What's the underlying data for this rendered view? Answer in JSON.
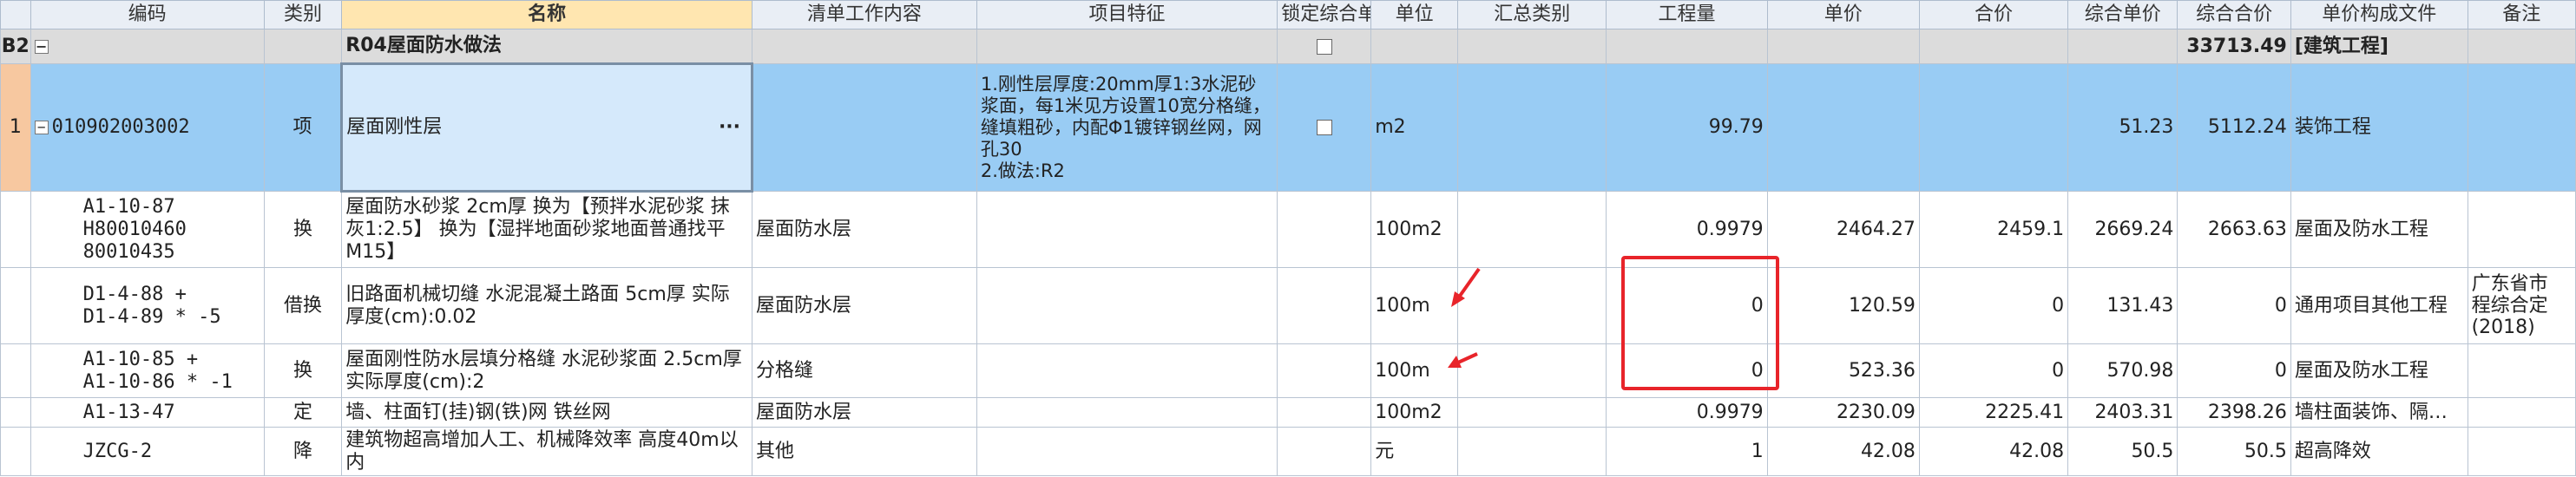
{
  "headers": [
    "",
    "编码",
    "类别",
    "名称",
    "清单工作内容",
    "项目特征",
    "锁定综合单价",
    "单位",
    "汇总类别",
    "工程量",
    "单价",
    "合价",
    "综合单价",
    "综合合价",
    "单价构成文件",
    "备注"
  ],
  "group_row": {
    "row_id": "B2",
    "name": "R04屋面防水做法",
    "total": "33713.49",
    "file": "[建筑工程]"
  },
  "selected_row": {
    "row_num": "1",
    "code": "010902003002",
    "type": "项",
    "name": "屋面刚性层",
    "ellipsis": "···",
    "feature": "1.刚性层厚度:20mm厚1:3水泥砂浆面，每1米见方设置10宽分格缝，缝填粗砂，内配Φ1镀锌钢丝网，网孔30\n2.做法:R2",
    "unit": "m2",
    "qty": "99.79",
    "comp_price": "51.23",
    "comp_total": "5112.24",
    "file": "装饰工程"
  },
  "rows": [
    {
      "code": "A1-10-87\nH80010460\n80010435",
      "type": "换",
      "name": "屋面防水砂浆 2cm厚  换为【预拌水泥砂浆 抹灰1:2.5】  换为【湿拌地面砂浆地面普通找平 M15】",
      "content": "屋面防水层",
      "unit": "100m2",
      "qty": "0.9979",
      "price": "2464.27",
      "total": "2459.1",
      "comp_price": "2669.24",
      "comp_total": "2663.63",
      "file": "屋面及防水工程",
      "remark": ""
    },
    {
      "code": "D1-4-88 +\nD1-4-89 * -5",
      "type": "借换",
      "name": "旧路面机械切缝 水泥混凝土路面 5cm厚  实际厚度(cm):0.02",
      "content": "屋面防水层",
      "unit": "100m",
      "qty": "0",
      "price": "120.59",
      "total": "0",
      "comp_price": "131.43",
      "comp_total": "0",
      "file": "通用项目其他工程",
      "remark": "广东省市\n程综合定\n(2018)"
    },
    {
      "code": "A1-10-85 +\nA1-10-86 * -1",
      "type": "换",
      "name": "屋面刚性防水层填分格缝 水泥砂浆面 2.5cm厚  实际厚度(cm):2",
      "content": "分格缝",
      "unit": "100m",
      "qty": "0",
      "price": "523.36",
      "total": "0",
      "comp_price": "570.98",
      "comp_total": "0",
      "file": "屋面及防水工程",
      "remark": ""
    },
    {
      "code": "A1-13-47",
      "type": "定",
      "name": "墙、柱面钉(挂)钢(铁)网 铁丝网",
      "content": "屋面防水层",
      "unit": "100m2",
      "qty": "0.9979",
      "price": "2230.09",
      "total": "2225.41",
      "comp_price": "2403.31",
      "comp_total": "2398.26",
      "file": "墙柱面装饰、隔…",
      "remark": ""
    },
    {
      "code": "JZCG-2",
      "type": "降",
      "name": "建筑物超高增加人工、机械降效率 高度40m以内",
      "content": "其他",
      "unit": "元",
      "qty": "1",
      "price": "42.08",
      "total": "42.08",
      "comp_price": "50.5",
      "comp_total": "50.5",
      "file": "超高降效",
      "remark": ""
    }
  ],
  "colors": {
    "header_bg": "#e9eef5",
    "selected_bg": "#99ccf4",
    "group_bg": "#dcdcdc",
    "highlight": "#e8242a"
  }
}
